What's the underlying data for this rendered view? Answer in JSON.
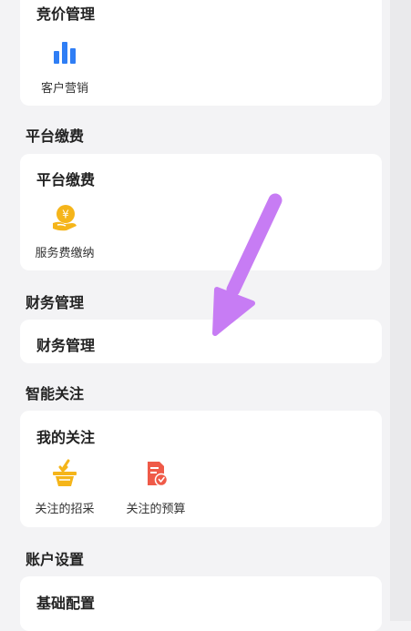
{
  "colors": {
    "page_bg": "#f3f3f5",
    "card_bg": "#ffffff",
    "blue": "#2f7ef5",
    "yellow": "#f5b51a",
    "red": "#ef5a48",
    "arrow": "#c77cf4"
  },
  "bidding": {
    "card_title": "竞价管理",
    "items": [
      {
        "label": "客户营销",
        "icon": "bar-chart-icon"
      }
    ]
  },
  "platform_fee": {
    "section_title": "平台缴费",
    "card_title": "平台缴费",
    "items": [
      {
        "label": "服务费缴纳",
        "icon": "yuan-hand-icon"
      }
    ]
  },
  "finance": {
    "section_title": "财务管理",
    "card_title": "财务管理"
  },
  "smart_follow": {
    "section_title": "智能关注",
    "card_title": "我的关注",
    "items": [
      {
        "label": "关注的招采",
        "icon": "basket-icon"
      },
      {
        "label": "关注的预算",
        "icon": "budget-doc-icon"
      }
    ]
  },
  "account": {
    "section_title": "账户设置",
    "card_title": "基础配置"
  }
}
